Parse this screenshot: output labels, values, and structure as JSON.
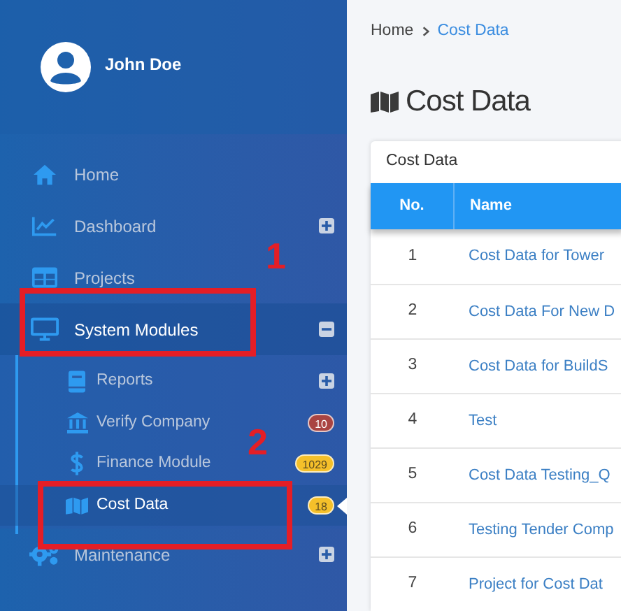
{
  "user": {
    "name": "John Doe"
  },
  "menu": [
    {
      "label": "Home",
      "kind": "link",
      "selected": false
    },
    {
      "label": "Dashboard",
      "kind": "group",
      "expanded": false,
      "selected": false
    },
    {
      "label": "Projects",
      "kind": "link",
      "selected": false
    },
    {
      "label": "System Modules",
      "kind": "group",
      "expanded": true,
      "selected": true,
      "children": [
        {
          "label": "Reports",
          "kind": "group",
          "expanded": false,
          "selected": false
        },
        {
          "label": "Verify Company",
          "kind": "link",
          "selected": false,
          "badge": {
            "text": "10",
            "color": "#a94442"
          }
        },
        {
          "label": "Finance Module",
          "kind": "link",
          "selected": false,
          "badge": {
            "text": "1029",
            "color": "#f5c02a"
          }
        },
        {
          "label": "Cost Data",
          "kind": "link",
          "selected": true,
          "badge": {
            "text": "18",
            "color": "#f5c02a"
          }
        }
      ]
    },
    {
      "label": "Maintenance",
      "kind": "group",
      "expanded": false,
      "selected": false
    }
  ],
  "breadcrumb": [
    "Home",
    "Cost Data"
  ],
  "page_title": "Cost Data",
  "card_title": "Cost Data",
  "table": {
    "columns": [
      "No.",
      "Name"
    ],
    "rows": [
      [
        "1",
        "Cost Data for Tower"
      ],
      [
        "2",
        "Cost Data For New D"
      ],
      [
        "3",
        "Cost Data for BuildS"
      ],
      [
        "4",
        "Test"
      ],
      [
        "5",
        "Cost Data Testing_Q"
      ],
      [
        "6",
        "Testing Tender Comp"
      ],
      [
        "7",
        "Project for Cost Dat"
      ]
    ]
  },
  "annotations": [
    {
      "label": "1"
    },
    {
      "label": "2"
    }
  ]
}
